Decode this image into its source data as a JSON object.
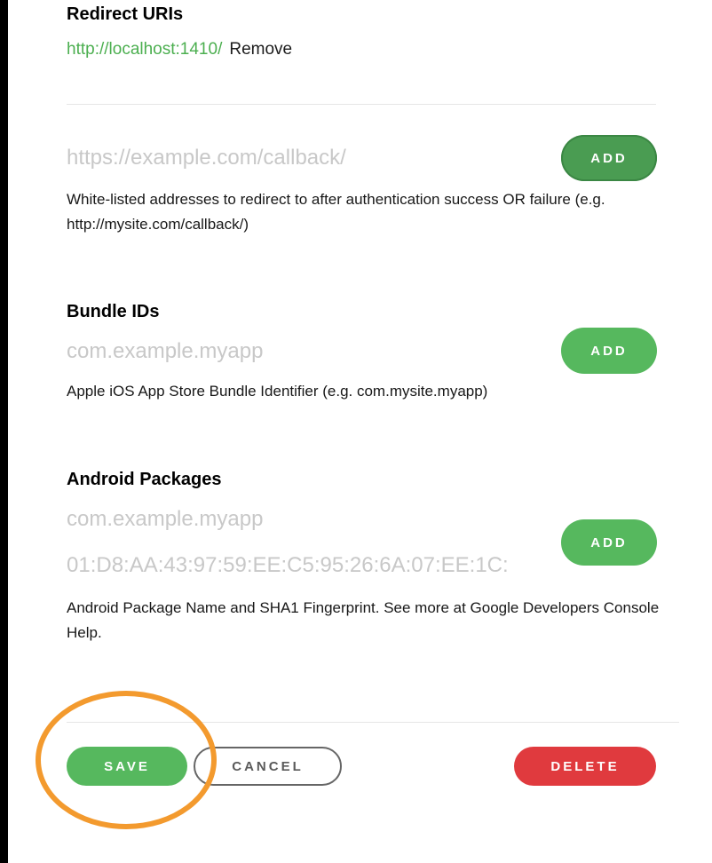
{
  "redirect": {
    "title": "Redirect URIs",
    "uri": "http://localhost:1410/",
    "remove_label": "Remove",
    "placeholder": "https://example.com/callback/",
    "add_label": "ADD",
    "help": "White-listed addresses to redirect to after authentication success OR failure (e.g. http://mysite.com/callback/)"
  },
  "bundle": {
    "title": "Bundle IDs",
    "placeholder": "com.example.myapp",
    "add_label": "ADD",
    "help": "Apple iOS App Store Bundle Identifier (e.g. com.mysite.myapp)"
  },
  "android": {
    "title": "Android Packages",
    "package_placeholder": "com.example.myapp",
    "fingerprint_placeholder": "01:D8:AA:43:97:59:EE:C5:95:26:6A:07:EE:1C:",
    "add_label": "ADD",
    "help": "Android Package Name and SHA1 Fingerprint. See more at Google Developers Console Help."
  },
  "actions": {
    "save_label": "SAVE",
    "cancel_label": "CANCEL",
    "delete_label": "DELETE"
  },
  "colors": {
    "accent_green": "#56b85e",
    "link_green": "#4caf50",
    "delete_red": "#e03a3e",
    "highlight_orange": "#f39a2e"
  }
}
